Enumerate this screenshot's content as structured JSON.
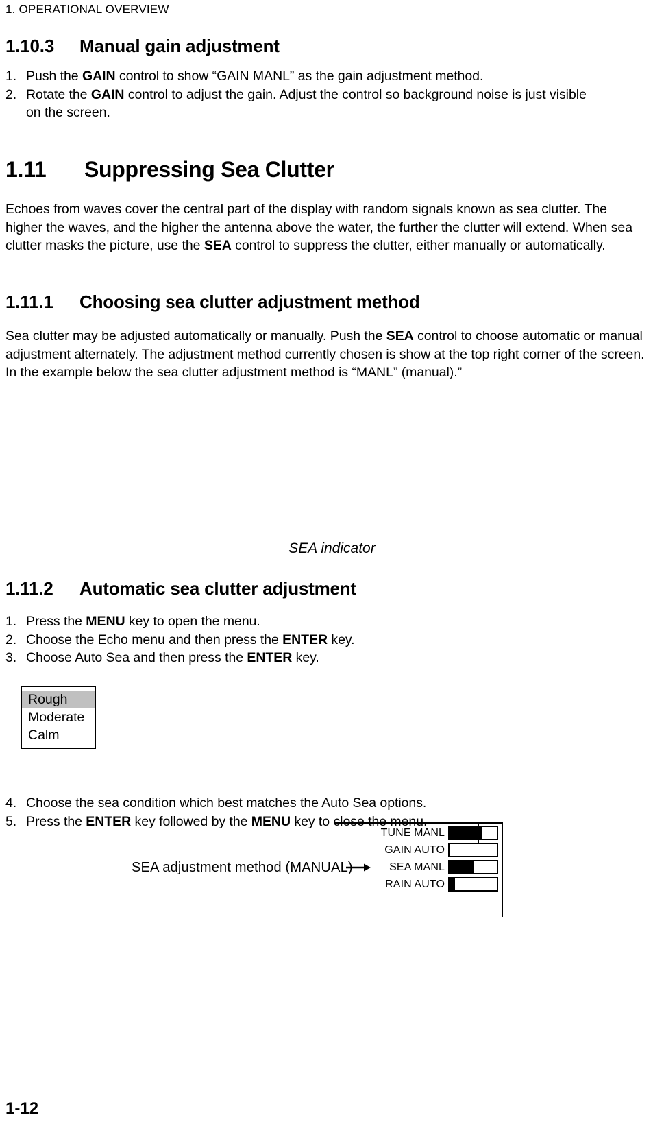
{
  "header": {
    "running_head": "1. OPERATIONAL OVERVIEW"
  },
  "sections": {
    "s1103": {
      "number": "1.10.3",
      "title": "Manual gain adjustment",
      "steps": [
        {
          "marker": "1.",
          "text_1": "Push the ",
          "bold_1": "GAIN",
          "text_2": " control to show “GAIN MANL” as the gain adjustment method."
        },
        {
          "marker": "2.",
          "text_1": "Rotate the ",
          "bold_1": "GAIN",
          "text_2": " control to adjust the gain. Adjust the control so background noise is just visible",
          "text_3": "on the screen."
        }
      ]
    },
    "s111": {
      "number": "1.11",
      "title": "Suppressing Sea Clutter",
      "para_line_1": "Echoes from waves cover the central part of the display with random signals known as sea clutter.",
      "para_line_2": "The higher the waves, and the higher the antenna above the water, the further the clutter will",
      "para_line_3a": "extend. When sea clutter masks the picture, use the ",
      "para_bold_1": "SEA",
      "para_line_3b": " control to suppress the clutter, either",
      "para_line_4": "manually or automatically."
    },
    "s1111": {
      "number": "1.11.1",
      "title": "Choosing sea clutter adjustment method",
      "para_line_1a": "Sea clutter may be adjusted automatically or manually. Push the ",
      "para_bold_1": "SEA",
      "para_line_1b": " control to choose automatic",
      "para_line_2": "or manual adjustment alternately. The adjustment method currently chosen is show at the top right",
      "para_line_3": "corner of the screen. In the example below the sea clutter adjustment method is “MANL”",
      "para_line_4": "(manual).”"
    },
    "s1112": {
      "number": "1.11.2",
      "title": "Automatic sea clutter adjustment",
      "steps": [
        {
          "marker": "1.",
          "text_1": "Press the ",
          "bold_1": "MENU",
          "text_2": " key to open the menu."
        },
        {
          "marker": "2.",
          "text_1": "Choose the Echo menu and then press the ",
          "bold_1": "ENTER",
          "text_2": " key."
        },
        {
          "marker": "3.",
          "text_1": "Choose Auto Sea and then press the ",
          "bold_1": "ENTER",
          "text_2": " key."
        }
      ],
      "steps_after": [
        {
          "marker": "4.",
          "text_1": "Choose the sea condition which best matches the Auto Sea options."
        },
        {
          "marker": "5.",
          "text_1": "Press the ",
          "bold_1": "ENTER",
          "text_2": " key followed by the ",
          "bold_2": "MENU",
          "text_3": " key to close the menu."
        }
      ]
    }
  },
  "figure": {
    "annotation": "SEA adjustment method (MANUAL)",
    "caption": "SEA indicator",
    "arrow_glyph": "→",
    "indicator_rows": [
      {
        "label": "TUNE MANL",
        "fill_percent": 68,
        "tick_percent": 60,
        "has_tick": true
      },
      {
        "label": "GAIN AUTO",
        "fill_percent": 0,
        "tick_percent": 0,
        "has_tick": false
      },
      {
        "label": "SEA  MANL",
        "fill_percent": 50,
        "tick_percent": 0,
        "has_tick": false
      },
      {
        "label": "RAIN AUTO",
        "fill_percent": 11,
        "tick_percent": 0,
        "has_tick": false
      }
    ]
  },
  "auto_sea_menu": {
    "options": [
      "Rough",
      "Moderate",
      "Calm"
    ],
    "selected": "Rough",
    "selected_bg": "#c0c0c0"
  },
  "footer": {
    "page_number": "1-12"
  }
}
